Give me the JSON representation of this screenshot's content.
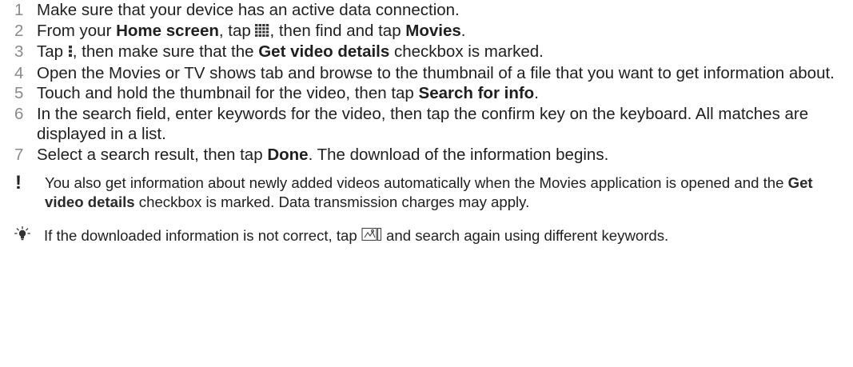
{
  "steps": [
    {
      "n": "1",
      "text": "Make sure that your device has an active data connection."
    },
    {
      "n": "2",
      "a": "From your ",
      "b1": "Home screen",
      "c": ", tap ",
      "d": ", then find and tap ",
      "b2": "Movies",
      "e": "."
    },
    {
      "n": "3",
      "a": "Tap ",
      "b": ", then make sure that the ",
      "bold": "Get video details",
      "c": " checkbox is marked."
    },
    {
      "n": "4",
      "text": "Open the Movies or TV shows tab and browse to the thumbnail of a file that you want to get information about."
    },
    {
      "n": "5",
      "a": "Touch and hold the thumbnail for the video, then tap ",
      "bold": "Search for info",
      "b": "."
    },
    {
      "n": "6",
      "text": "In the search field, enter keywords for the video, then tap the confirm key on the keyboard. All matches are displayed in a list."
    },
    {
      "n": "7",
      "a": "Select a search result, then tap ",
      "bold": "Done",
      "b": ". The download of the information begins."
    }
  ],
  "note": {
    "mark": "!",
    "a": "You also get information about newly added videos automatically when the Movies application is opened and the ",
    "bold": "Get video details",
    "b": " checkbox is marked. Data transmission charges may apply."
  },
  "tip": {
    "a": "If the downloaded information is not correct, tap ",
    "b": " and search again using different keywords."
  },
  "icons": {
    "apps": "app-grid-icon",
    "menu": "overflow-menu-icon",
    "important": "exclamation-icon",
    "tip": "lightbulb-icon",
    "edit": "edit-info-icon"
  }
}
